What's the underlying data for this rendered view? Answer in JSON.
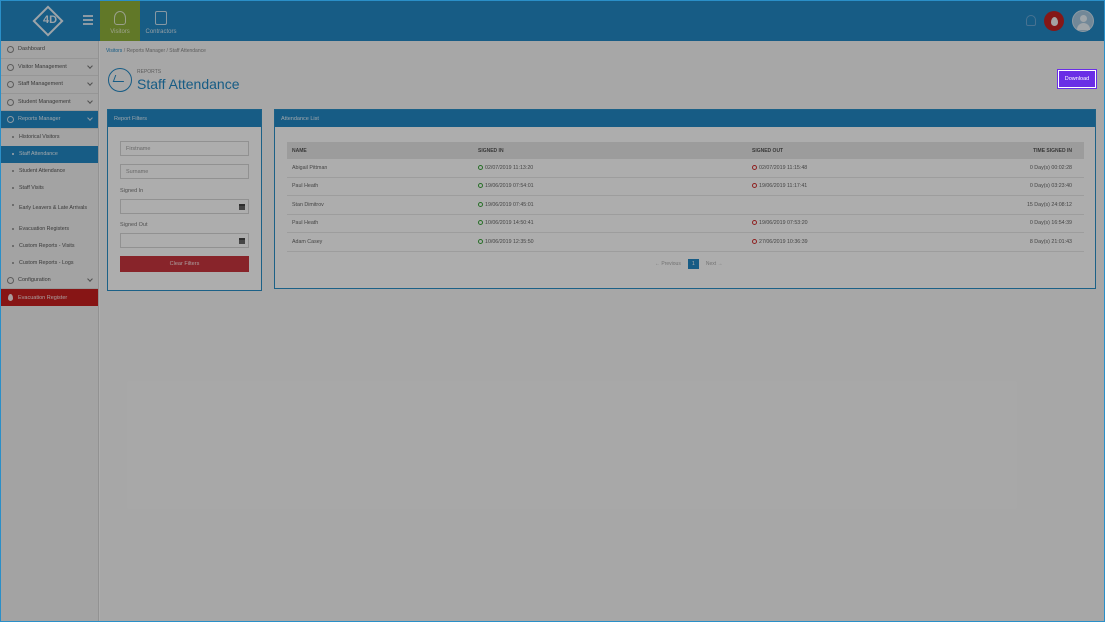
{
  "topbar": {
    "logo_text": "4D",
    "tabs": [
      {
        "label": "Visitors",
        "icon": "visitor-icon"
      },
      {
        "label": "Contractors",
        "icon": "clipboard-icon"
      }
    ]
  },
  "sidebar": {
    "items": [
      {
        "label": "Dashboard",
        "icon": "dashboard-icon"
      },
      {
        "label": "Visitor Management",
        "icon": "user-icon"
      },
      {
        "label": "Staff Management",
        "icon": "staff-icon"
      },
      {
        "label": "Student Management",
        "icon": "student-icon"
      },
      {
        "label": "Reports Manager",
        "icon": "reports-icon"
      }
    ],
    "reports_sub": [
      "Historical Visitors",
      "Staff Attendance",
      "Student Attendance",
      "Staff Visits",
      "Early Leavers & Late Arrivals",
      "Evacuation Registers",
      "Custom Reports - Visits",
      "Custom Reports - Logs"
    ],
    "configuration": "Configuration",
    "evacuation": "Evacuation Register"
  },
  "breadcrumb": {
    "root": "Visitors",
    "middle": "Reports Manager",
    "current": "Staff Attendance"
  },
  "page": {
    "subtitle": "Reports",
    "title": "Staff Attendance",
    "download_label": "Download"
  },
  "filters": {
    "header": "Report Filters",
    "firstname_placeholder": "Firstname",
    "surname_placeholder": "Surname",
    "signed_in_label": "Signed In",
    "signed_out_label": "Signed Out",
    "clear_label": "Clear Filters"
  },
  "attendance": {
    "header": "Attendance List",
    "columns": [
      "Name",
      "Signed In",
      "Signed Out",
      "Time Signed In"
    ],
    "rows": [
      {
        "name": "Abigail Pittman",
        "in": "02/07/2019 11:13:20",
        "out": "02/07/2019 11:15:48",
        "time": "0 Day(s) 00:02:28"
      },
      {
        "name": "Paul Heath",
        "in": "19/06/2019 07:54:01",
        "out": "19/06/2019 11:17:41",
        "time": "0 Day(s) 03:23:40"
      },
      {
        "name": "Stan Dimitrov",
        "in": "19/06/2019 07:45:01",
        "out": "",
        "time": "15 Day(s) 24:08:12"
      },
      {
        "name": "Paul Heath",
        "in": "10/06/2019 14:50:41",
        "out": "19/06/2019 07:53:20",
        "time": "0 Day(s) 16:54:39"
      },
      {
        "name": "Adam Casey",
        "in": "10/06/2019 12:35:50",
        "out": "27/06/2019 10:36:39",
        "time": "8 Day(s) 21:01:43"
      }
    ],
    "pager": {
      "prev": "← Previous",
      "page": "1",
      "next": "Next →"
    }
  }
}
